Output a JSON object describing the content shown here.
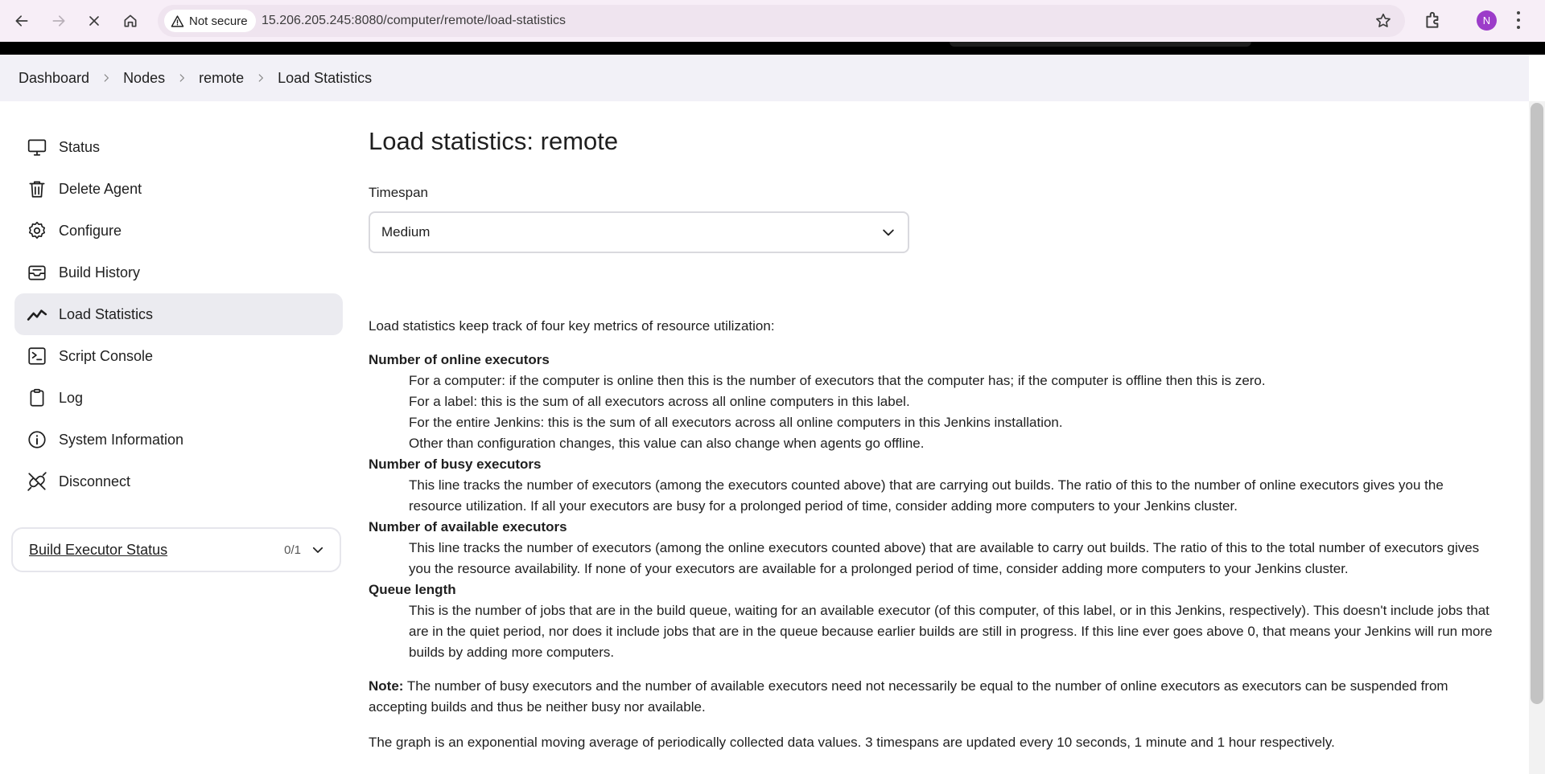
{
  "browser": {
    "security_label": "Not secure",
    "url": "15.206.205.245:8080/computer/remote/load-statistics",
    "profile_initial": "N"
  },
  "breadcrumb": [
    {
      "label": "Dashboard"
    },
    {
      "label": "Nodes"
    },
    {
      "label": "remote"
    },
    {
      "label": "Load Statistics"
    }
  ],
  "sidebar": {
    "items": [
      {
        "label": "Status",
        "icon": "monitor-icon"
      },
      {
        "label": "Delete Agent",
        "icon": "trash-icon"
      },
      {
        "label": "Configure",
        "icon": "gear-icon"
      },
      {
        "label": "Build History",
        "icon": "inbox-icon"
      },
      {
        "label": "Load Statistics",
        "icon": "trend-line-icon"
      },
      {
        "label": "Script Console",
        "icon": "terminal-icon"
      },
      {
        "label": "Log",
        "icon": "clipboard-icon"
      },
      {
        "label": "System Information",
        "icon": "info-icon"
      },
      {
        "label": "Disconnect",
        "icon": "unplug-icon"
      }
    ],
    "active_index": 4,
    "executor_status": {
      "title": "Build Executor Status",
      "count": "0/1"
    }
  },
  "main": {
    "title": "Load statistics: remote",
    "timespan_label": "Timespan",
    "timespan_value": "Medium",
    "intro": "Load statistics keep track of four key metrics of resource utilization:",
    "metrics": [
      {
        "term": "Number of online executors",
        "lines": [
          "For a computer: if the computer is online then this is the number of executors that the computer has; if the computer is offline then this is zero.",
          "For a label: this is the sum of all executors across all online computers in this label.",
          "For the entire Jenkins: this is the sum of all executors across all online computers in this Jenkins installation.",
          "Other than configuration changes, this value can also change when agents go offline."
        ]
      },
      {
        "term": "Number of busy executors",
        "lines": [
          "This line tracks the number of executors (among the executors counted above) that are carrying out builds. The ratio of this to the number of online executors gives you the resource utilization. If all your executors are busy for a prolonged period of time, consider adding more computers to your Jenkins cluster."
        ]
      },
      {
        "term": "Number of available executors",
        "lines": [
          "This line tracks the number of executors (among the online executors counted above) that are available to carry out builds. The ratio of this to the total number of executors gives you the resource availability. If none of your executors are available for a prolonged period of time, consider adding more computers to your Jenkins cluster."
        ]
      },
      {
        "term": "Queue length",
        "lines": [
          "This is the number of jobs that are in the build queue, waiting for an available executor (of this computer, of this label, or in this Jenkins, respectively). This doesn't include jobs that are in the quiet period, nor does it include jobs that are in the queue because earlier builds are still in progress. If this line ever goes above 0, that means your Jenkins will run more builds by adding more computers."
        ]
      }
    ],
    "note_label": "Note:",
    "note_text": "The number of busy executors and the number of available executors need not necessarily be equal to the number of online executors as executors can be suspended from accepting builds and thus be neither busy nor available.",
    "graph_text": "The graph is an exponential moving average of periodically collected data values. 3 timespans are updated every 10 seconds, 1 minute and 1 hour respectively."
  }
}
